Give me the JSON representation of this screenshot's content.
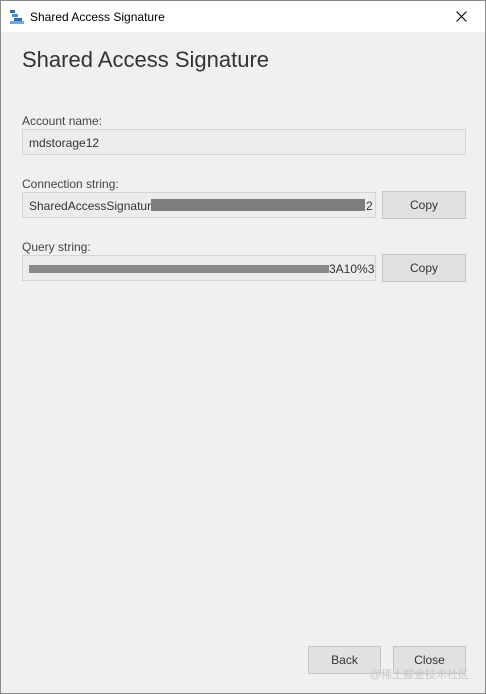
{
  "window": {
    "title": "Shared Access Signature",
    "heading": "Shared Access Signature"
  },
  "account": {
    "label": "Account name:",
    "value": "mdstorage12"
  },
  "connection": {
    "label": "Connection string:",
    "value_visible_start": "SharedAccessSignature",
    "value_visible_end": "2",
    "copy_label": "Copy"
  },
  "query": {
    "label": "Query string:",
    "value_visible_end": "3A10%3",
    "copy_label": "Copy"
  },
  "footer": {
    "back_label": "Back",
    "close_label": "Close"
  },
  "watermark": "@稀土掘金技术社区",
  "icons": {
    "app": "storage-explorer-icon",
    "close": "close-icon"
  }
}
